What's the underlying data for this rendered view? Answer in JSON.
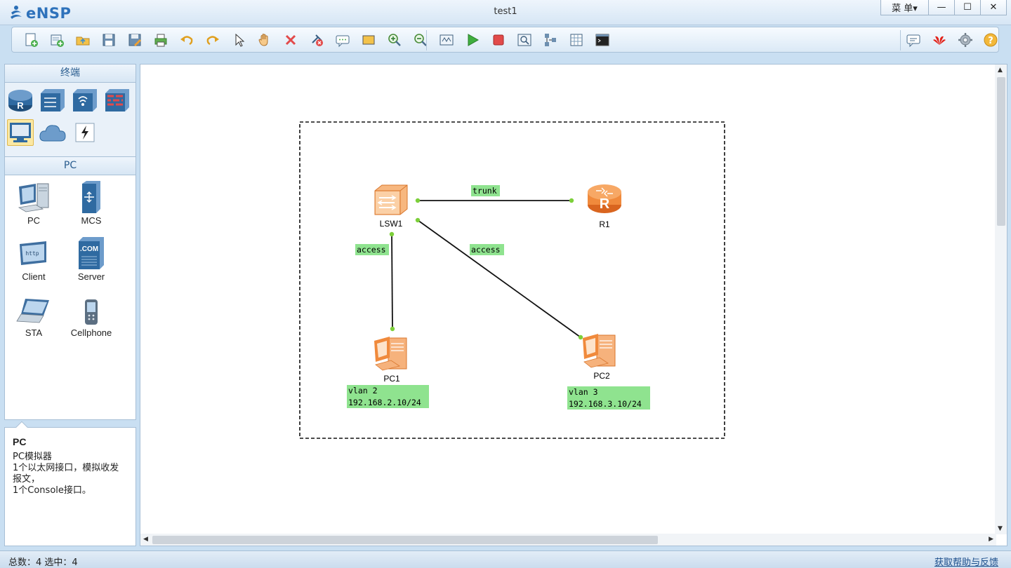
{
  "app": {
    "name": "eNSP",
    "window_title": "test1"
  },
  "window_controls": {
    "menu": "菜 单▾",
    "minimize": "—",
    "maximize": "☐",
    "close": "✕"
  },
  "toolbar": {
    "left_icons": [
      "new-topology-icon",
      "new-example-icon",
      "open-icon",
      "save-icon",
      "save-as-icon",
      "print-icon",
      "undo-icon",
      "redo-icon",
      "select-pointer-icon",
      "pan-hand-icon",
      "delete-icon",
      "delete-link-icon",
      "add-text-icon",
      "add-shape-icon",
      "zoom-in-icon",
      "zoom-out-icon",
      "fit-view-icon",
      "start-devices-icon",
      "stop-devices-icon",
      "capture-data-icon",
      "topology-layout-icon",
      "show-grid-icon",
      "command-line-icon"
    ],
    "right_icons": [
      "chat-icon",
      "huawei-logo-icon",
      "settings-gear-icon",
      "help-icon"
    ]
  },
  "sidebar": {
    "category_header": "终端",
    "categories": [
      {
        "icon": "router-category-icon",
        "selected": false
      },
      {
        "icon": "switch-category-icon",
        "selected": false
      },
      {
        "icon": "wireless-category-icon",
        "selected": false
      },
      {
        "icon": "firewall-category-icon",
        "selected": false
      },
      {
        "icon": "terminal-category-icon",
        "selected": true
      },
      {
        "icon": "cloud-category-icon",
        "selected": false
      },
      {
        "icon": "link-category-icon",
        "selected": false
      }
    ],
    "device_header": "PC",
    "devices": [
      {
        "label": "PC",
        "icon": "pc-icon"
      },
      {
        "label": "MCS",
        "icon": "mcs-server-icon"
      },
      {
        "label": "Client",
        "icon": "http-client-icon"
      },
      {
        "label": "Server",
        "icon": "com-server-icon"
      },
      {
        "label": "STA",
        "icon": "laptop-sta-icon"
      },
      {
        "label": "Cellphone",
        "icon": "cellphone-icon"
      }
    ]
  },
  "info": {
    "title": "PC",
    "lines": [
      "PC模拟器",
      "1个以太网接口，模拟收发报文，",
      "1个Console接口。"
    ]
  },
  "topology": {
    "devices": [
      {
        "id": "lsw1",
        "name": "LSW1",
        "type": "switch"
      },
      {
        "id": "r1",
        "name": "R1",
        "type": "router"
      },
      {
        "id": "pc1",
        "name": "PC1",
        "type": "pc"
      },
      {
        "id": "pc2",
        "name": "PC2",
        "type": "pc"
      }
    ],
    "links": [
      {
        "from": "LSW1",
        "to": "R1",
        "label": "trunk"
      },
      {
        "from": "LSW1",
        "to": "PC1",
        "label": "access"
      },
      {
        "from": "LSW1",
        "to": "PC2",
        "label": "access"
      }
    ],
    "notes": [
      {
        "device": "PC1",
        "vlan": "vlan 2",
        "ip": "192.168.2.10/24"
      },
      {
        "device": "PC2",
        "vlan": "vlan 3",
        "ip": "192.168.3.10/24"
      }
    ]
  },
  "status": {
    "summary": "总数：4  选中：4",
    "help_link": "获取帮助与反馈"
  },
  "colors": {
    "label_bg": "#8fe38f",
    "link_dot": "#7ccf3a",
    "device_orange": "#f08a3c"
  }
}
